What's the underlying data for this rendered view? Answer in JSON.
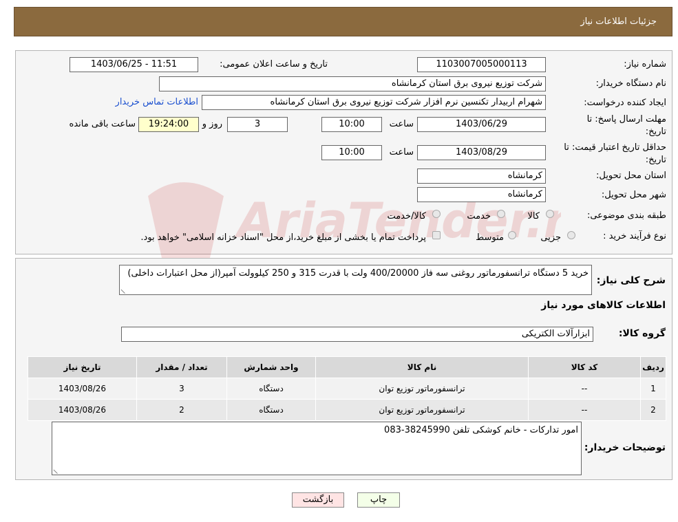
{
  "header": {
    "title": "جزئیات اطلاعات نیاز"
  },
  "fields": {
    "need_number_label": "شماره نیاز:",
    "need_number": "1103007005000113",
    "announce_label": "تاریخ و ساعت اعلان عمومی:",
    "announce_value": "1403/06/25 - 11:51",
    "buyer_org_label": "نام دستگاه خریدار:",
    "buyer_org": "شرکت توزیع نیروی برق استان کرمانشاه",
    "creator_label": "ایجاد کننده درخواست:",
    "creator": "شهرام اربیدار تکنسین نرم افزار شرکت توزیع نیروی برق استان کرمانشاه",
    "contact_link": "اطلاعات تماس خریدار",
    "deadline_label": "مهلت ارسال پاسخ: تا تاریخ:",
    "deadline_date": "1403/06/29",
    "time_label": "ساعت",
    "deadline_time": "10:00",
    "days_value": "3",
    "days_label": "روز و",
    "remaining_time": "19:24:00",
    "remaining_label": "ساعت باقی مانده",
    "validity_label": "حداقل تاریخ اعتبار قیمت: تا تاریخ:",
    "validity_date": "1403/08/29",
    "validity_time": "10:00",
    "province_label": "استان محل تحویل:",
    "province": "کرمانشاه",
    "city_label": "شهر محل تحویل:",
    "city": "کرمانشاه",
    "category_label": "طبقه بندی موضوعی:",
    "category_options": [
      "کالا",
      "خدمت",
      "کالا/خدمت"
    ],
    "process_label": "نوع فرآیند خرید :",
    "process_options": [
      "جزیی",
      "متوسط"
    ],
    "process_note": "پرداخت تمام یا بخشی از مبلغ خرید،از محل \"اسناد خزانه اسلامی\" خواهد بود."
  },
  "description": {
    "label": "شرح کلی نیاز:",
    "text": "خرید 5 دستگاه ترانسفورماتور روغنی سه فاز 400/20000 ولت با قدرت 315 و 250 کیلوولت آمپر(از محل اعتبارات داخلی)"
  },
  "goods": {
    "section_title": "اطلاعات کالاهای مورد نیاز",
    "group_label": "گروه کالا:",
    "group_value": "ابزارآلات الکتریکی",
    "columns": [
      "ردیف",
      "کد کالا",
      "نام کالا",
      "واحد شمارش",
      "تعداد / مقدار",
      "تاریخ نیاز"
    ],
    "rows": [
      [
        "1",
        "--",
        "ترانسفورماتور توزیع توان",
        "دستگاه",
        "3",
        "1403/08/26"
      ],
      [
        "2",
        "--",
        "ترانسفورماتور توزیع توان",
        "دستگاه",
        "2",
        "1403/08/26"
      ]
    ]
  },
  "buyer_notes": {
    "label": "توضیحات خریدار:",
    "text": "امور تدارکات - خانم کوشکی تلفن 38245990-083"
  },
  "buttons": {
    "print": "چاپ",
    "back": "بازگشت"
  },
  "watermark": "AriaTender.neT"
}
